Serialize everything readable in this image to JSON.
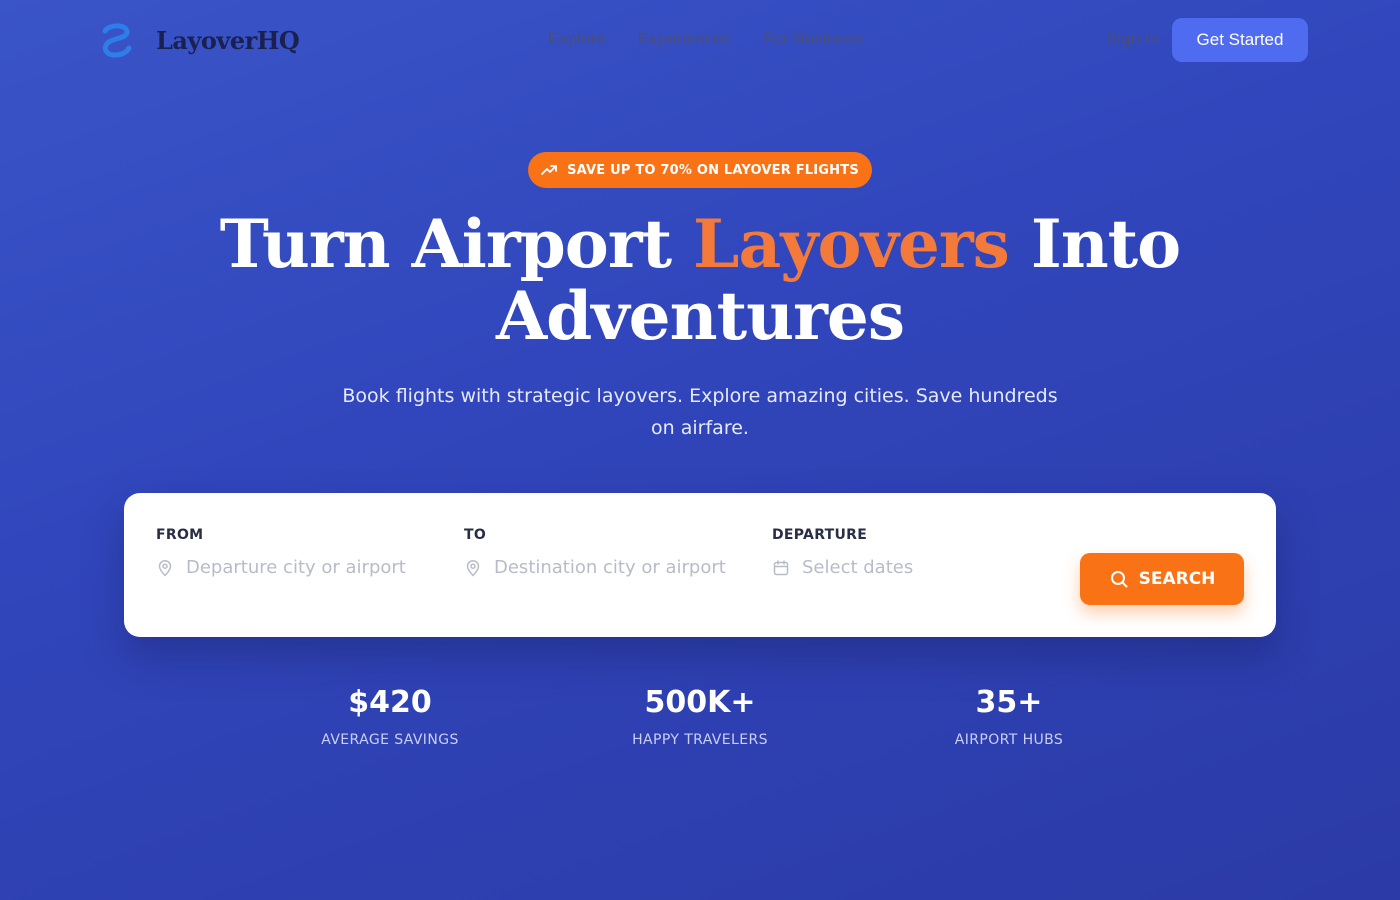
{
  "nav": {
    "brand": "LayoverHQ",
    "links": [
      "Explore",
      "Experiences",
      "For Business"
    ],
    "sign_in": "Sign In",
    "get_started": "Get Started"
  },
  "hero": {
    "badge": "SAVE UP TO 70% ON LAYOVER FLIGHTS",
    "headline_part1": "Turn Airport ",
    "headline_accent": "Layovers",
    "headline_part2": " Into",
    "headline_line2": "Adventures",
    "subtitle": "Book flights with strategic layovers. Explore amazing cities. Save hundreds on airfare."
  },
  "search": {
    "from_label": "FROM",
    "from_placeholder": "Departure city or airport",
    "to_label": "TO",
    "to_placeholder": "Destination city or airport",
    "departure_label": "DEPARTURE",
    "departure_placeholder": "Select dates",
    "button_label": "SEARCH"
  },
  "stats": [
    {
      "value": "$420",
      "label": "AVERAGE SAVINGS"
    },
    {
      "value": "500K+",
      "label": "HAPPY TRAVELERS"
    },
    {
      "value": "35+",
      "label": "AIRPORT HUBS"
    }
  ],
  "icons": {
    "logo": "logo-mark-icon",
    "badge": "trending-up-icon",
    "from": "map-pin-icon",
    "to": "map-pin-icon",
    "departure": "calendar-icon",
    "search": "search-icon"
  },
  "colors": {
    "accent_orange": "#f97316",
    "primary_blue": "#4f6bf0",
    "background": "#3146bc"
  }
}
